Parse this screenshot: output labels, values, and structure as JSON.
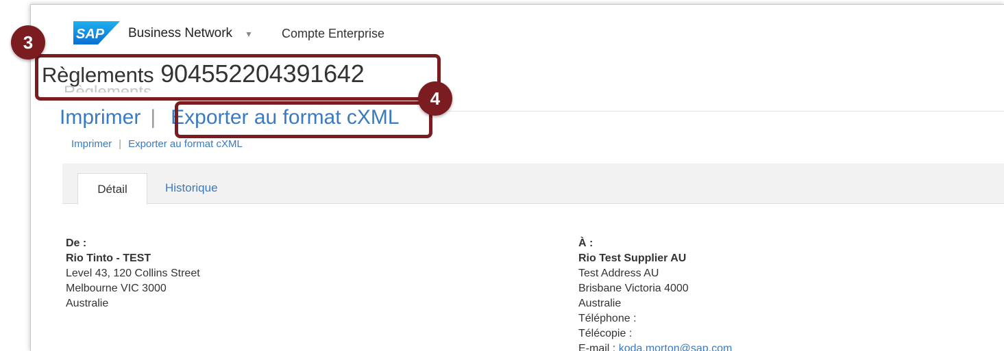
{
  "header": {
    "logo_text": "SAP",
    "brand": "Business Network",
    "account": "Compte Enterprise"
  },
  "page": {
    "title_prefix": "Règlements",
    "title_number": "904552204391642"
  },
  "actions": {
    "print": "Imprimer",
    "export": "Exporter au format cXML",
    "separator": "|"
  },
  "tabs": [
    {
      "label": "Détail",
      "active": true
    },
    {
      "label": "Historique",
      "active": false
    }
  ],
  "from": {
    "heading": "De :",
    "name": "Rio Tinto - TEST",
    "lines": [
      "Level 43, 120 Collins Street",
      "Melbourne VIC 3000",
      "Australie"
    ]
  },
  "to": {
    "heading": "À :",
    "name": "Rio Test Supplier AU",
    "lines": [
      "Test Address AU",
      "Brisbane Victoria 4000",
      "Australie"
    ],
    "phone_label": "Téléphone :",
    "fax_label": "Télécopie :",
    "email_label": "E-mail :",
    "email": "koda.morton@sap.com"
  },
  "callouts": {
    "step3": "3",
    "step4": "4"
  },
  "colors": {
    "callout": "#7a1c20",
    "link": "#3a7ac0",
    "sap_blue": "#0a6ed1"
  },
  "icons": {
    "brand_menu": "chevron-down-icon"
  }
}
